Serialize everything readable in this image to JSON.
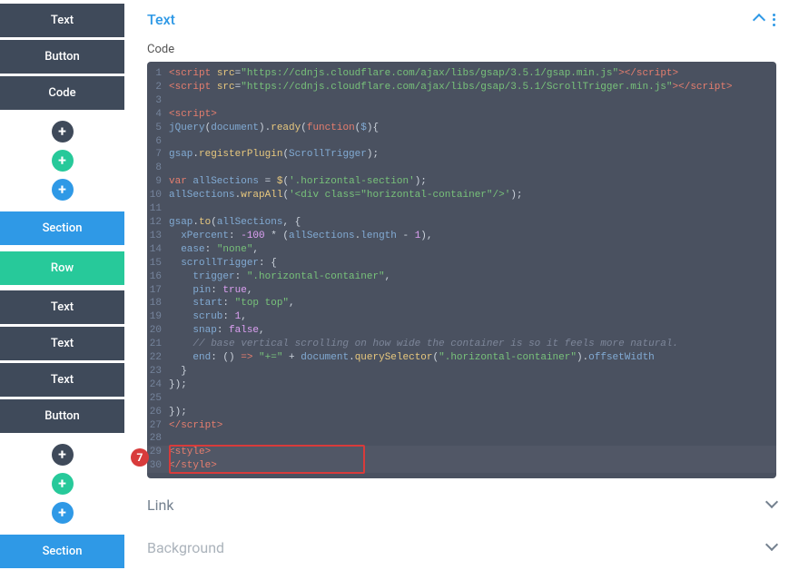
{
  "sidebar": {
    "block1": [
      "Text",
      "Button",
      "Code"
    ],
    "section": "Section",
    "row": "Row",
    "block2": [
      "Text",
      "Text",
      "Text",
      "Button"
    ],
    "section2": "Section",
    "plus": "+"
  },
  "panel": {
    "title": "Text",
    "code_label": "Code",
    "link_title": "Link",
    "background_title": "Background"
  },
  "callout_number": "7",
  "code": {
    "lines": [
      {
        "n": 1,
        "segs": [
          [
            "t-tag",
            "<script "
          ],
          [
            "t-attr",
            "src"
          ],
          [
            "t-punc",
            "="
          ],
          [
            "t-str",
            "\"https://cdnjs.cloudflare.com/ajax/libs/gsap/3.5.1/gsap.min.js\""
          ],
          [
            "t-tag",
            "></script>"
          ]
        ]
      },
      {
        "n": 2,
        "segs": [
          [
            "t-tag",
            "<script "
          ],
          [
            "t-attr",
            "src"
          ],
          [
            "t-punc",
            "="
          ],
          [
            "t-str",
            "\"https://cdnjs.cloudflare.com/ajax/libs/gsap/3.5.1/ScrollTrigger.min.js\""
          ],
          [
            "t-tag",
            "></script>"
          ]
        ]
      },
      {
        "n": 3,
        "segs": [
          [
            "t-punc",
            ""
          ]
        ]
      },
      {
        "n": 4,
        "segs": [
          [
            "t-tag",
            "<script>"
          ]
        ]
      },
      {
        "n": 5,
        "segs": [
          [
            "t-id",
            "jQuery"
          ],
          [
            "t-punc",
            "("
          ],
          [
            "t-id",
            "document"
          ],
          [
            "t-punc",
            ")."
          ],
          [
            "t-func",
            "ready"
          ],
          [
            "t-punc",
            "("
          ],
          [
            "t-key",
            "function"
          ],
          [
            "t-punc",
            "("
          ],
          [
            "t-id",
            "$"
          ],
          [
            "t-punc",
            "){ "
          ]
        ]
      },
      {
        "n": 6,
        "segs": [
          [
            "t-punc",
            ""
          ]
        ]
      },
      {
        "n": 7,
        "segs": [
          [
            "t-id",
            "gsap"
          ],
          [
            "t-punc",
            "."
          ],
          [
            "t-func",
            "registerPlugin"
          ],
          [
            "t-punc",
            "("
          ],
          [
            "t-id",
            "ScrollTrigger"
          ],
          [
            "t-punc",
            ");"
          ]
        ]
      },
      {
        "n": 8,
        "segs": [
          [
            "t-punc",
            ""
          ]
        ]
      },
      {
        "n": 9,
        "segs": [
          [
            "t-key",
            "var "
          ],
          [
            "t-id",
            "allSections"
          ],
          [
            "t-punc",
            " = "
          ],
          [
            "t-func",
            "$"
          ],
          [
            "t-punc",
            "("
          ],
          [
            "t-str",
            "'.horizontal-section'"
          ],
          [
            "t-punc",
            ");"
          ]
        ]
      },
      {
        "n": 10,
        "segs": [
          [
            "t-id",
            "allSections"
          ],
          [
            "t-punc",
            "."
          ],
          [
            "t-func",
            "wrapAll"
          ],
          [
            "t-punc",
            "("
          ],
          [
            "t-str",
            "'<div class=\"horizontal-container\"/>'"
          ],
          [
            "t-punc",
            ");"
          ]
        ]
      },
      {
        "n": 11,
        "segs": [
          [
            "t-punc",
            ""
          ]
        ]
      },
      {
        "n": 12,
        "segs": [
          [
            "t-id",
            "gsap"
          ],
          [
            "t-punc",
            "."
          ],
          [
            "t-func",
            "to"
          ],
          [
            "t-punc",
            "("
          ],
          [
            "t-id",
            "allSections"
          ],
          [
            "t-punc",
            ", {"
          ]
        ]
      },
      {
        "n": 13,
        "segs": [
          [
            "t-punc",
            "  "
          ],
          [
            "t-id",
            "xPercent"
          ],
          [
            "t-punc",
            ": "
          ],
          [
            "t-num",
            "-100"
          ],
          [
            "t-punc",
            " * ("
          ],
          [
            "t-id",
            "allSections"
          ],
          [
            "t-punc",
            "."
          ],
          [
            "t-id",
            "length"
          ],
          [
            "t-punc",
            " - "
          ],
          [
            "t-num",
            "1"
          ],
          [
            "t-punc",
            "),"
          ]
        ]
      },
      {
        "n": 14,
        "segs": [
          [
            "t-punc",
            "  "
          ],
          [
            "t-id",
            "ease"
          ],
          [
            "t-punc",
            ": "
          ],
          [
            "t-str",
            "\"none\""
          ],
          [
            "t-punc",
            ","
          ]
        ]
      },
      {
        "n": 15,
        "segs": [
          [
            "t-punc",
            "  "
          ],
          [
            "t-id",
            "scrollTrigger"
          ],
          [
            "t-punc",
            ": {"
          ]
        ]
      },
      {
        "n": 16,
        "segs": [
          [
            "t-punc",
            "    "
          ],
          [
            "t-id",
            "trigger"
          ],
          [
            "t-punc",
            ": "
          ],
          [
            "t-str",
            "\".horizontal-container\""
          ],
          [
            "t-punc",
            ","
          ]
        ]
      },
      {
        "n": 17,
        "segs": [
          [
            "t-punc",
            "    "
          ],
          [
            "t-id",
            "pin"
          ],
          [
            "t-punc",
            ": "
          ],
          [
            "t-bool",
            "true"
          ],
          [
            "t-punc",
            ","
          ]
        ]
      },
      {
        "n": 18,
        "segs": [
          [
            "t-punc",
            "    "
          ],
          [
            "t-id",
            "start"
          ],
          [
            "t-punc",
            ": "
          ],
          [
            "t-str",
            "\"top top\""
          ],
          [
            "t-punc",
            ","
          ]
        ]
      },
      {
        "n": 19,
        "segs": [
          [
            "t-punc",
            "    "
          ],
          [
            "t-id",
            "scrub"
          ],
          [
            "t-punc",
            ": "
          ],
          [
            "t-num",
            "1"
          ],
          [
            "t-punc",
            ","
          ]
        ]
      },
      {
        "n": 20,
        "segs": [
          [
            "t-punc",
            "    "
          ],
          [
            "t-id",
            "snap"
          ],
          [
            "t-punc",
            ": "
          ],
          [
            "t-bool",
            "false"
          ],
          [
            "t-punc",
            ","
          ]
        ]
      },
      {
        "n": 21,
        "segs": [
          [
            "t-punc",
            "    "
          ],
          [
            "t-com",
            "// base vertical scrolling on how wide the container is so it feels more natural."
          ]
        ]
      },
      {
        "n": 22,
        "segs": [
          [
            "t-punc",
            "    "
          ],
          [
            "t-id",
            "end"
          ],
          [
            "t-punc",
            ": () "
          ],
          [
            "t-key",
            "=>"
          ],
          [
            "t-punc",
            " "
          ],
          [
            "t-str",
            "\"+=\""
          ],
          [
            "t-punc",
            " + "
          ],
          [
            "t-id",
            "document"
          ],
          [
            "t-punc",
            "."
          ],
          [
            "t-func",
            "querySelector"
          ],
          [
            "t-punc",
            "("
          ],
          [
            "t-str",
            "\".horizontal-container\""
          ],
          [
            "t-punc",
            ")."
          ],
          [
            "t-id",
            "offsetWidth"
          ]
        ]
      },
      {
        "n": 23,
        "segs": [
          [
            "t-punc",
            "  }"
          ]
        ]
      },
      {
        "n": 24,
        "segs": [
          [
            "t-punc",
            "});"
          ]
        ]
      },
      {
        "n": 25,
        "segs": [
          [
            "t-punc",
            ""
          ]
        ]
      },
      {
        "n": 26,
        "segs": [
          [
            "t-punc",
            "});"
          ]
        ]
      },
      {
        "n": 27,
        "segs": [
          [
            "t-tag",
            "</script>"
          ]
        ]
      },
      {
        "n": 28,
        "segs": [
          [
            "t-punc",
            ""
          ]
        ]
      },
      {
        "n": 29,
        "segs": [
          [
            "t-tag",
            "<style>"
          ]
        ],
        "hl": true
      },
      {
        "n": 30,
        "segs": [
          [
            "t-tag",
            "</style>"
          ]
        ],
        "hl": true
      }
    ]
  }
}
